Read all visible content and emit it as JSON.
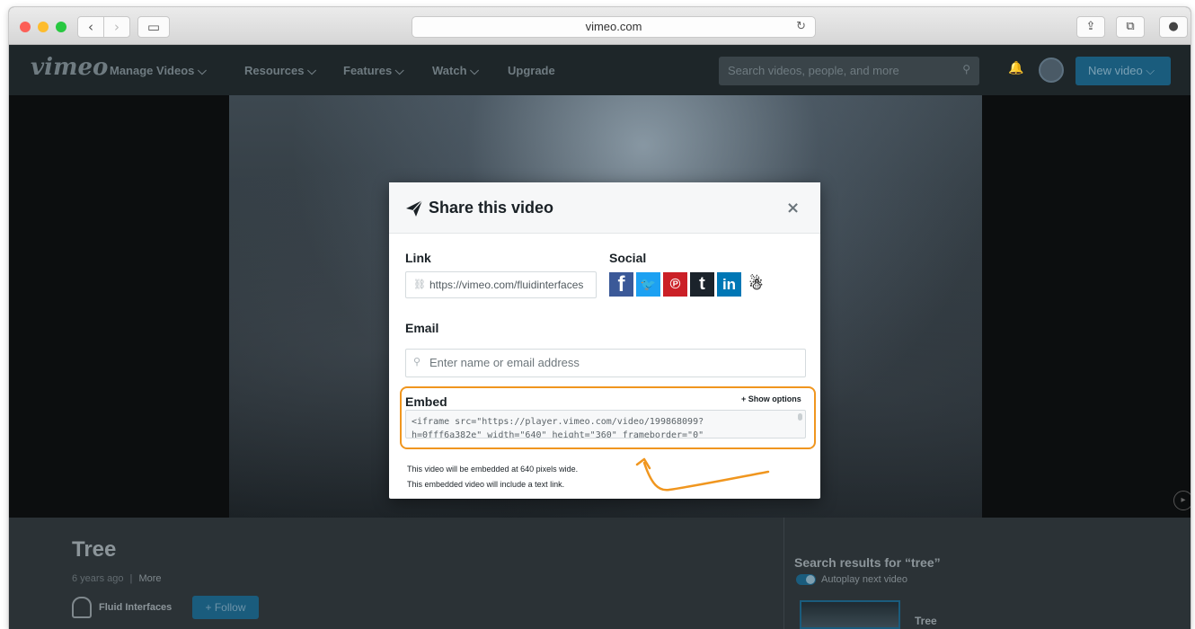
{
  "browser": {
    "url": "vimeo.com",
    "back_glyph": "‹",
    "forward_glyph": "›",
    "sidebar_glyph": "▭",
    "reload_glyph": "↻",
    "share_glyph": "⇪",
    "tabs_glyph": "⧉",
    "download_glyph": "●"
  },
  "header": {
    "logo": "vimeo",
    "nav": [
      "Manage Videos ⌵",
      "Resources ⌵",
      "Features ⌵",
      "Watch ⌵",
      "Upgrade"
    ],
    "search_placeholder": "Search videos, people, and more",
    "search_glyph": "⚲",
    "bell_glyph": "🔔",
    "new_video_label": "New video ⌵"
  },
  "video": {
    "title": "Tree",
    "age": "6 years ago",
    "meta_sep": "|",
    "more": "More",
    "owner": "Fluid Interfaces",
    "follow_label": "+ Follow"
  },
  "sidebar": {
    "search_results_title": "Search results for “tree”",
    "autoplay_label": "Autoplay next video",
    "first_result_title": "Tree"
  },
  "modal": {
    "title": "Share this video",
    "close_glyph": "×",
    "link_label": "Link",
    "link_value": "https://vimeo.com/fluidinterfaces",
    "link_glyph": "⛓",
    "social_label": "Social",
    "social": [
      {
        "name": "facebook",
        "glyph": "f"
      },
      {
        "name": "twitter",
        "glyph": "🐦"
      },
      {
        "name": "pinterest",
        "glyph": "℗"
      },
      {
        "name": "tumblr",
        "glyph": "t"
      },
      {
        "name": "linkedin",
        "glyph": "in"
      },
      {
        "name": "reddit",
        "glyph": "☃"
      }
    ],
    "email_label": "Email",
    "email_placeholder": "Enter name or email address",
    "email_glyph": "⚲",
    "embed_label": "Embed",
    "show_options": "+ Show options",
    "embed_code_line1": "<iframe src=\"https://player.vimeo.com/video/199868099?",
    "embed_code_line2": "h=0fff6a382e\" width=\"640\" height=\"360\" frameborder=\"0\"",
    "note_width": "This video will be embedded at 640 pixels wide.",
    "note_link": "This embedded video will include a text link."
  },
  "colors": {
    "highlight": "#f0961f",
    "vimeo_blue": "#1a5c7d"
  }
}
